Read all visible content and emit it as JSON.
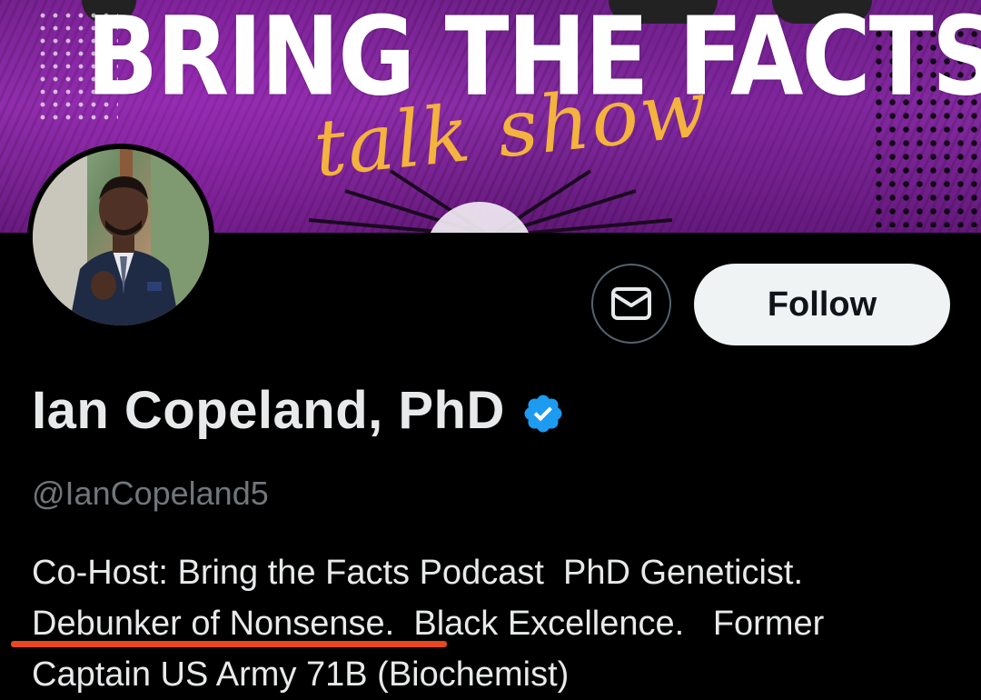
{
  "banner": {
    "title": "BRING THE FACTS",
    "script": "talk show"
  },
  "profile": {
    "name": "Ian Copeland, PhD",
    "handle": "@IanCopeland5",
    "verified_icon": "verified-badge-icon",
    "verified_color": "#1d9bf0",
    "bio_line1": "Co-Host: Bring the Facts Podcast  PhD Geneticist.",
    "bio_line2": "Debunker of Nonsense.  Black Excellence.   Former",
    "bio_line3": "Captain US Army 71B (Biochemist)"
  },
  "actions": {
    "message_icon": "envelope-icon",
    "follow_label": "Follow"
  },
  "annotation": {
    "underline_color": "#e8481c"
  }
}
